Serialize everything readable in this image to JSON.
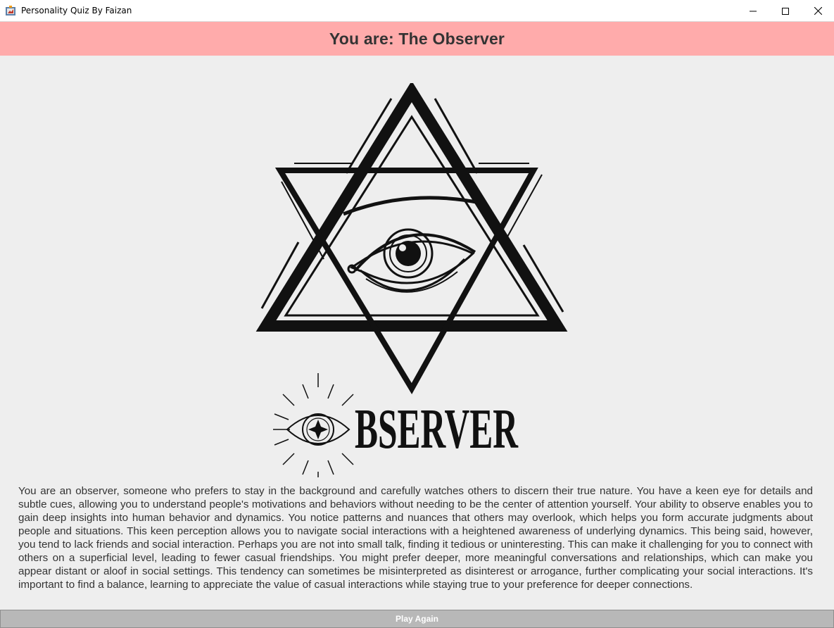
{
  "window": {
    "title": "Personality Quiz By Faizan",
    "icons": [
      "app-icon",
      "minimize-icon",
      "maximize-icon",
      "close-icon"
    ]
  },
  "result": {
    "heading": "You are: The Observer",
    "logo_text": "BSERVER",
    "description": "You are an observer, someone who prefers to stay in the background and carefully watches others to discern their true nature. You have a keen eye for details and subtle cues, allowing you to understand people's motivations and behaviors without needing to be the center of attention yourself. Your ability to observe enables you to gain deep insights into human behavior and dynamics. You notice patterns and nuances that others may overlook, which helps you form accurate judgments about people and situations. This keen perception allows you to navigate social interactions with a heightened awareness of underlying dynamics. This being said, however, you tend to lack friends and social interaction. Perhaps you are not into small talk, finding it tedious or uninteresting. This can make it challenging for you to connect with others on a superficial level, leading to fewer casual friendships. You might prefer deeper, more meaningful conversations and relationships, which can make you appear distant or aloof in social settings. This tendency can sometimes be misinterpreted as disinterest or arrogance, further complicating your social interactions. It's important to find a balance, learning to appreciate the value of casual interactions while staying true to your preference for deeper connections."
  },
  "actions": {
    "play_again_label": "Play Again"
  },
  "colors": {
    "header_bg": "#ffabab",
    "page_bg": "#eeeeee",
    "text": "#333333",
    "button_bg": "#b8b8b8"
  }
}
